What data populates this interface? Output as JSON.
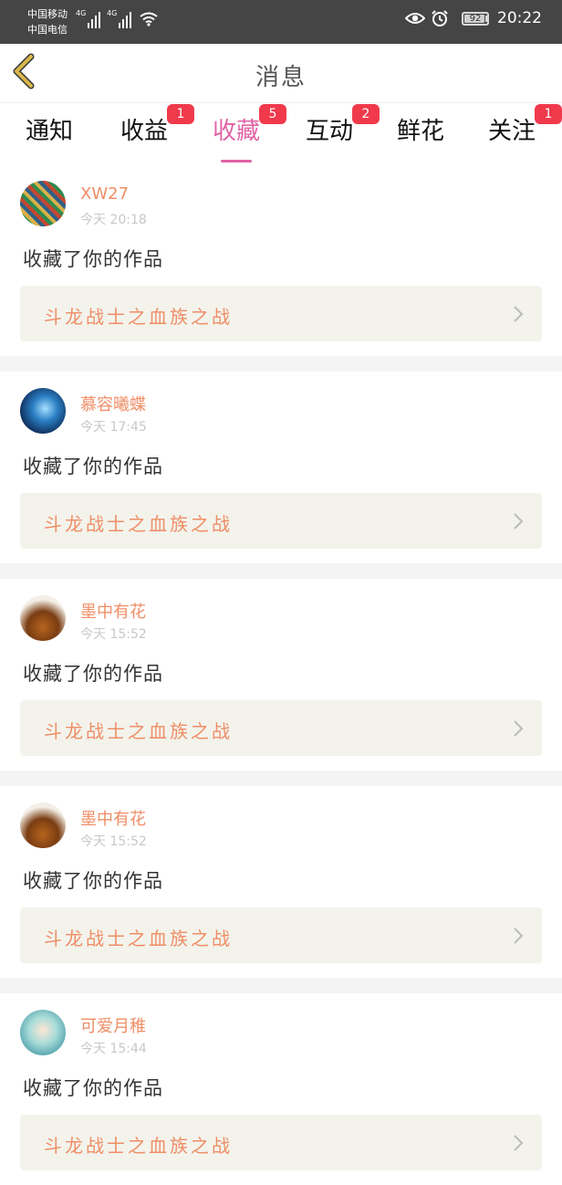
{
  "statusbar": {
    "carrier_1": "中国移动",
    "carrier_2": "中国电信",
    "signal_1_tag": "4G",
    "signal_2_tag": "4G",
    "battery": "92",
    "battery_level": 0.92,
    "time": "20:22",
    "icons": [
      "signal-icon",
      "wifi-icon",
      "eye-icon",
      "alarm-icon",
      "battery-icon"
    ]
  },
  "header": {
    "title": "消息",
    "back_icon": "chevron-left-icon"
  },
  "tabs": [
    {
      "label": "通知",
      "badge": ""
    },
    {
      "label": "收益",
      "badge": "1"
    },
    {
      "label": "收藏",
      "badge": "5",
      "active": true
    },
    {
      "label": "互动",
      "badge": "2"
    },
    {
      "label": "鲜花",
      "badge": ""
    },
    {
      "label": "关注",
      "badge": "1"
    }
  ],
  "messages": [
    {
      "user": "XW27",
      "time": "今天 20:18",
      "text": "收藏了你的作品",
      "work": "斗龙战士之血族之战"
    },
    {
      "user": "慕容曦蝶",
      "time": "今天 17:45",
      "text": "收藏了你的作品",
      "work": "斗龙战士之血族之战"
    },
    {
      "user": "墨中有花",
      "time": "今天 15:52",
      "text": "收藏了你的作品",
      "work": "斗龙战士之血族之战"
    },
    {
      "user": "墨中有花",
      "time": "今天 15:52",
      "text": "收藏了你的作品",
      "work": "斗龙战士之血族之战"
    },
    {
      "user": "可爱月稚",
      "time": "今天 15:44",
      "text": "收藏了你的作品",
      "work": "斗龙战士之血族之战"
    }
  ],
  "colors": {
    "accent_tab": "#e063a6",
    "username": "#ef8e66",
    "badge": "#f03a4c",
    "back_arrow": "#d9b84a",
    "work_box_bg": "#f3f3ec"
  }
}
